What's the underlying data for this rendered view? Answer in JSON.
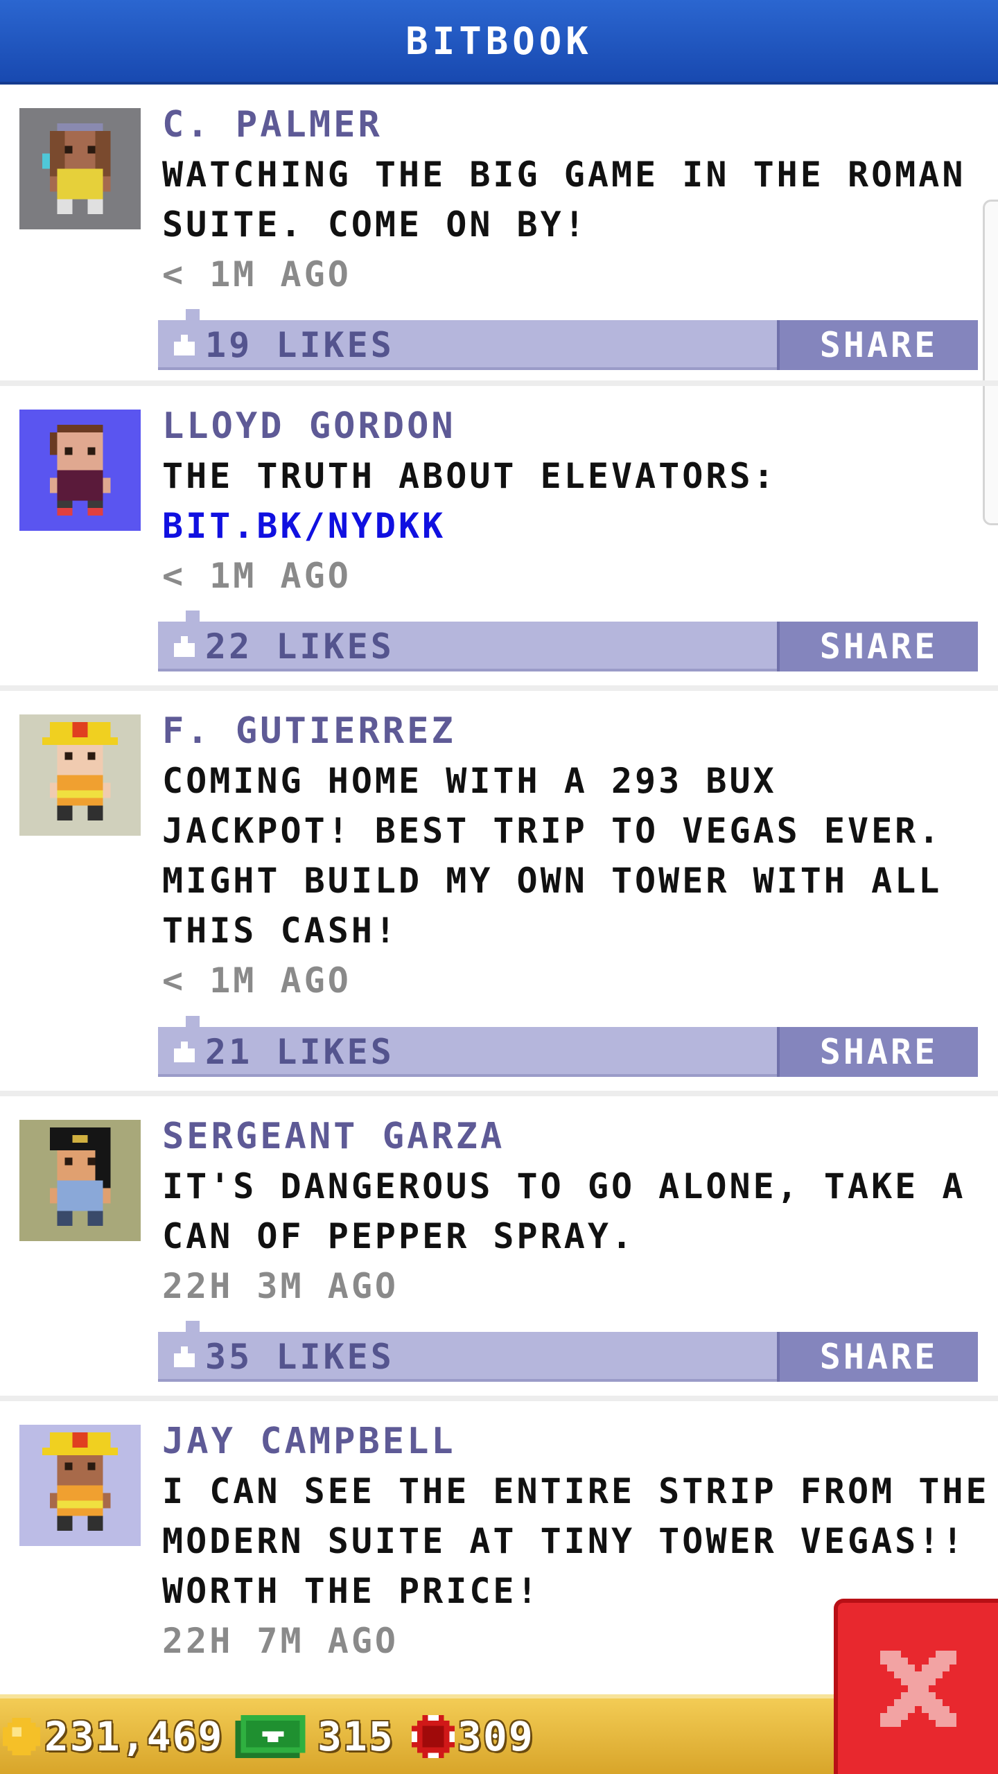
{
  "header": {
    "title": "BITBOOK"
  },
  "posts": [
    {
      "author": "C. PALMER",
      "message": "WATCHING THE BIG GAME IN THE ROMAN\nSUITE. COME ON BY!",
      "link": "",
      "time": "< 1M AGO",
      "likes": "19 LIKES",
      "share": "SHARE"
    },
    {
      "author": "LLOYD GORDON",
      "message": "THE TRUTH ABOUT ELEVATORS:",
      "link": "BIT.BK/NYDKK",
      "time": "< 1M AGO",
      "likes": "22 LIKES",
      "share": "SHARE"
    },
    {
      "author": "F. GUTIERREZ",
      "message": "COMING HOME WITH A 293 BUX\nJACKPOT! BEST TRIP TO VEGAS EVER.\nMIGHT BUILD MY OWN TOWER WITH ALL\nTHIS CASH!",
      "link": "",
      "time": "< 1M AGO",
      "likes": "21 LIKES",
      "share": "SHARE"
    },
    {
      "author": "SERGEANT GARZA",
      "message": "IT'S DANGEROUS TO GO ALONE, TAKE A\nCAN OF PEPPER SPRAY.",
      "link": "",
      "time": "22H 3M AGO",
      "likes": "35 LIKES",
      "share": "SHARE"
    },
    {
      "author": "JAY CAMPBELL",
      "message": "I CAN SEE THE ENTIRE STRIP FROM THE\nMODERN SUITE AT TINY TOWER VEGAS!!\nWORTH THE PRICE!",
      "link": "",
      "time": "22H 7M AGO",
      "likes": "",
      "share": ""
    }
  ],
  "status_bar": {
    "coins": "231,469",
    "bux": "315",
    "chips": "309"
  },
  "icons": {
    "coin": "coin-icon",
    "bux": "bux-icon",
    "chip": "chip-icon",
    "thumb": "thumbs-up-icon",
    "close": "close-icon"
  },
  "colors": {
    "header": "#1f56c0",
    "author": "#5e5a96",
    "link": "#1010e0",
    "action_bar": "#b5b6dc",
    "share": "#8485bd",
    "bottom_bar": "#e6b73a",
    "close": "#e8282e"
  }
}
